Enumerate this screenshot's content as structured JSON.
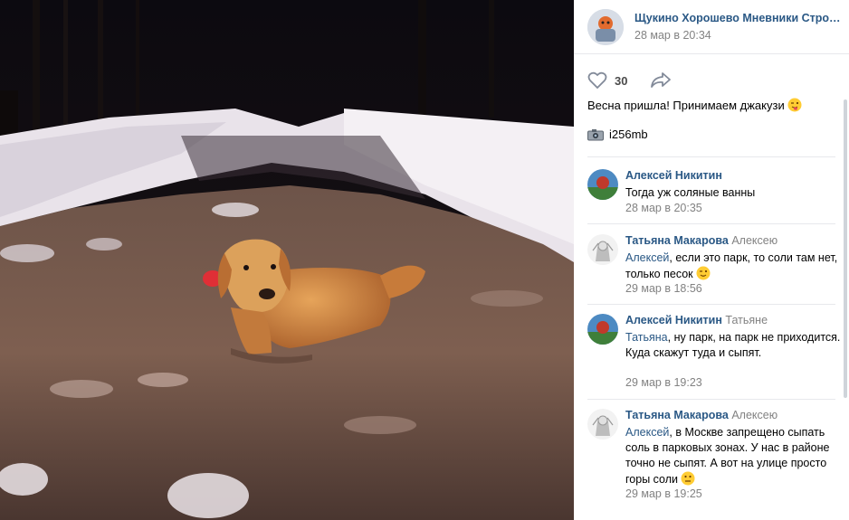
{
  "post": {
    "group_name": "Щукино Хорошево Мневники Стро…",
    "date": "28 мар в 20:34",
    "likes": "30",
    "text": "Весна пришла! Принимаем джакузи",
    "photo_tag": "i256mb",
    "icons": [
      "heart-icon",
      "share-arrow-icon",
      "camera-icon",
      "wink-tongue-emoji"
    ]
  },
  "comments": [
    {
      "author": "Алексей Никитин",
      "reply_to": "",
      "addressee": "",
      "text": "Тогда уж соляные ванны",
      "date": "28 мар в 20:35"
    },
    {
      "author": "Татьяна Макарова",
      "reply_to": "Алексею",
      "addressee": "Алексей",
      "text": ", если это парк, то соли там нет, только песок",
      "date": "29 мар в 18:56"
    },
    {
      "author": "Алексей Никитин",
      "reply_to": "Татьяне",
      "addressee": "Татьяна",
      "text": ", ну парк, на парк не приходится. Куда скажут туда и сыпят.",
      "date": "29 мар в 19:23"
    },
    {
      "author": "Татьяна Макарова",
      "reply_to": "Алексею",
      "addressee": "Алексей",
      "text": ", в Москве запрещено сыпать соль в парковых зонах. У нас в районе точно не сыпят. А вот на улице просто горы соли",
      "date": "29 мар в 19:25"
    }
  ],
  "colors": {
    "link": "#2a5885",
    "muted": "#828282",
    "divider": "#e7e8ec"
  }
}
